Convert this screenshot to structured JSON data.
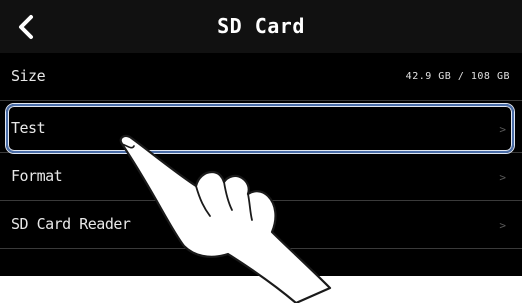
{
  "header": {
    "back_icon": "chevron-left-icon",
    "title": "SD Card"
  },
  "menu": [
    {
      "label": "Size",
      "value": "42.9 GB /  108 GB"
    },
    {
      "label": "Test",
      "chevron": ">"
    },
    {
      "label": "Format",
      "chevron": ">"
    },
    {
      "label": "SD Card Reader",
      "chevron": ">"
    }
  ],
  "overlay": {
    "selected_item": "Test",
    "gesture_icon": "pointing-hand-icon"
  },
  "colors": {
    "background": "#000000",
    "highlight_border": "#4a6da8"
  }
}
